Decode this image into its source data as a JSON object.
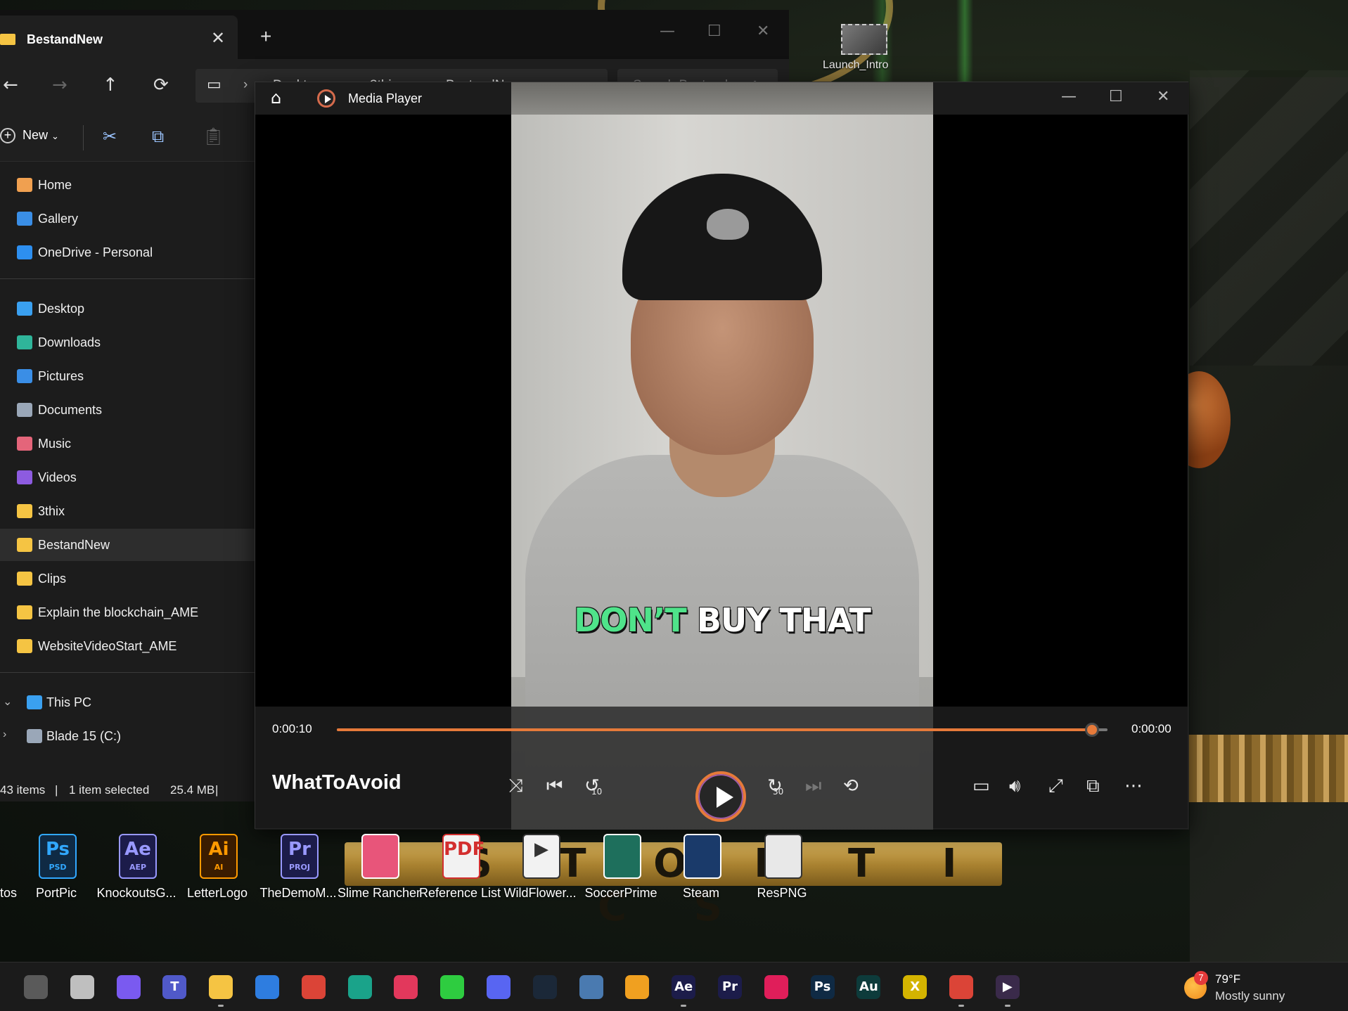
{
  "desktop": {
    "top_thumbnail_label": "Launch_Intro",
    "banner_text": "O S T O     E T I C S",
    "partial_left_label": "tos",
    "icons": [
      {
        "label": "PortPic",
        "badge": "Ps",
        "sub": "PSD",
        "color": "#0f2a44",
        "fg": "#31a8ff"
      },
      {
        "label": "KnockoutsG...",
        "badge": "Ae",
        "sub": "AEP",
        "color": "#1c1c4a",
        "fg": "#9999ff"
      },
      {
        "label": "LetterLogo",
        "badge": "Ai",
        "sub": "AI",
        "color": "#3a1c00",
        "fg": "#ff9a00"
      },
      {
        "label": "TheDemoM...",
        "badge": "Pr",
        "sub": "PROJ",
        "color": "#1c1c4a",
        "fg": "#9999ff"
      },
      {
        "label": "Slime Rancher",
        "badge": "",
        "sub": "",
        "color": "#e8557a",
        "fg": "#fff"
      },
      {
        "label": "Reference List",
        "badge": "PDF",
        "sub": "",
        "color": "#f2f2f2",
        "fg": "#d32f2f"
      },
      {
        "label": "WildFlower...",
        "badge": "▶",
        "sub": "",
        "color": "#f2f2f2",
        "fg": "#333"
      },
      {
        "label": "SoccerPrime",
        "badge": "",
        "sub": "",
        "color": "#1e6f5c",
        "fg": "#fff"
      },
      {
        "label": "Steam",
        "badge": "",
        "sub": "",
        "color": "#1a3a6a",
        "fg": "#fff"
      },
      {
        "label": "ResPNG",
        "badge": "",
        "sub": "",
        "color": "#e8e8e8",
        "fg": "#333"
      }
    ]
  },
  "explorer": {
    "tab_title": "BestandNew",
    "tab_close": "✕",
    "new_tab": "+",
    "window_controls": {
      "minimize": "—",
      "maximize": "☐",
      "close": "✕"
    },
    "nav": {
      "back": "←",
      "forward": "→",
      "up": "↑",
      "refresh": "⟳"
    },
    "breadcrumb_icon": "▭",
    "breadcrumbs": [
      "Desktop",
      "3thix",
      "BestandNew"
    ],
    "search_placeholder": "Search Bestand",
    "command_bar": {
      "new_label": "New",
      "new_plus": "+",
      "new_chevron": "⌄"
    },
    "sidebar": {
      "quick": [
        {
          "label": "Home",
          "icon": "home-icon",
          "color": "#f0a050"
        },
        {
          "label": "Gallery",
          "icon": "gallery-icon",
          "color": "#3a8ee6"
        },
        {
          "label": "OneDrive - Personal",
          "icon": "onedrive-icon",
          "color": "#2d8ff0"
        }
      ],
      "pinned": [
        {
          "label": "Desktop",
          "icon": "desktop-icon",
          "color": "#3aa0f0"
        },
        {
          "label": "Downloads",
          "icon": "downloads-icon",
          "color": "#2fb59a"
        },
        {
          "label": "Pictures",
          "icon": "pictures-icon",
          "color": "#3a8ee6"
        },
        {
          "label": "Documents",
          "icon": "documents-icon",
          "color": "#9aa7b8"
        },
        {
          "label": "Music",
          "icon": "music-icon",
          "color": "#e4657a"
        },
        {
          "label": "Videos",
          "icon": "videos-icon",
          "color": "#8d5be0"
        },
        {
          "label": "3thix",
          "icon": "folder-icon",
          "color": "#f5c443"
        },
        {
          "label": "BestandNew",
          "icon": "folder-icon",
          "color": "#f5c443",
          "selected": true
        },
        {
          "label": "Clips",
          "icon": "folder-icon",
          "color": "#f5c443"
        },
        {
          "label": "Explain the blockchain_AME",
          "icon": "folder-icon",
          "color": "#f5c443"
        },
        {
          "label": "WebsiteVideoStart_AME",
          "icon": "folder-icon",
          "color": "#f5c443"
        }
      ],
      "devices": [
        {
          "label": "This PC",
          "icon": "pc-icon",
          "color": "#3aa0f0",
          "expander": "⌄"
        },
        {
          "label": "Blade 15 (C:)",
          "icon": "drive-icon",
          "color": "#9aa7b8",
          "expander": "›"
        }
      ]
    },
    "status": {
      "items": "43 items",
      "selected": "1 item selected",
      "size": "25.4 MB",
      "divider": "|"
    }
  },
  "player": {
    "app_title": "Media Player",
    "home_glyph": "⌂",
    "window_controls": {
      "minimize": "—",
      "maximize": "☐",
      "close": "✕"
    },
    "caption": {
      "green": "DON’T",
      "white": "BUY THAT"
    },
    "time_current": "0:00:10",
    "time_end": "0:00:00",
    "progress": 0.98,
    "clip_name": "WhatToAvoid",
    "controls": {
      "shuffle": "⤨",
      "previous": "⏮",
      "rewind": "↺",
      "rewind_label": "10",
      "forward": "↻",
      "forward_label": "30",
      "next": "⏭",
      "repeat": "⟲",
      "captions": "▭",
      "volume": "🔊︎",
      "fullscreen": "⤢",
      "miniplayer": "⧉",
      "more": "⋯"
    }
  },
  "taskbar": {
    "apps": [
      {
        "name": "widgets",
        "label": "",
        "color": "#5a5a5a"
      },
      {
        "name": "task-view",
        "label": "",
        "color": "#bfbfbf"
      },
      {
        "name": "copilot",
        "label": "",
        "color": "#7a5af0"
      },
      {
        "name": "teams",
        "label": "T",
        "color": "#5059c9"
      },
      {
        "name": "file-explorer",
        "label": "",
        "color": "#f5c443"
      },
      {
        "name": "store",
        "label": "",
        "color": "#2e7de0"
      },
      {
        "name": "chrome",
        "label": "",
        "color": "#db4437"
      },
      {
        "name": "edge",
        "label": "",
        "color": "#1aa38a"
      },
      {
        "name": "creative-cloud",
        "label": "",
        "color": "#e2385c"
      },
      {
        "name": "xbox-app",
        "label": "",
        "color": "#2ecc40"
      },
      {
        "name": "discord",
        "label": "",
        "color": "#5865f2"
      },
      {
        "name": "steam",
        "label": "",
        "color": "#1b2838"
      },
      {
        "name": "resource-monitor",
        "label": "",
        "color": "#4a7ab0"
      },
      {
        "name": "game-app",
        "label": "",
        "color": "#f0a020"
      },
      {
        "name": "after-effects",
        "label": "Ae",
        "color": "#1c1c4a"
      },
      {
        "name": "premiere",
        "label": "Pr",
        "color": "#1c1c4a"
      },
      {
        "name": "slack",
        "label": "",
        "color": "#e01e5a"
      },
      {
        "name": "photoshop",
        "label": "Ps",
        "color": "#0f2a44"
      },
      {
        "name": "audition",
        "label": "Au",
        "color": "#0d3b3b"
      },
      {
        "name": "xsplit",
        "label": "X",
        "color": "#d4b400"
      },
      {
        "name": "chrome-2",
        "label": "",
        "color": "#db4437"
      },
      {
        "name": "media-player",
        "label": "▶",
        "color": "#3a2a4a"
      }
    ],
    "weather": {
      "badge": "7",
      "temp": "79°F",
      "desc": "Mostly sunny"
    }
  }
}
